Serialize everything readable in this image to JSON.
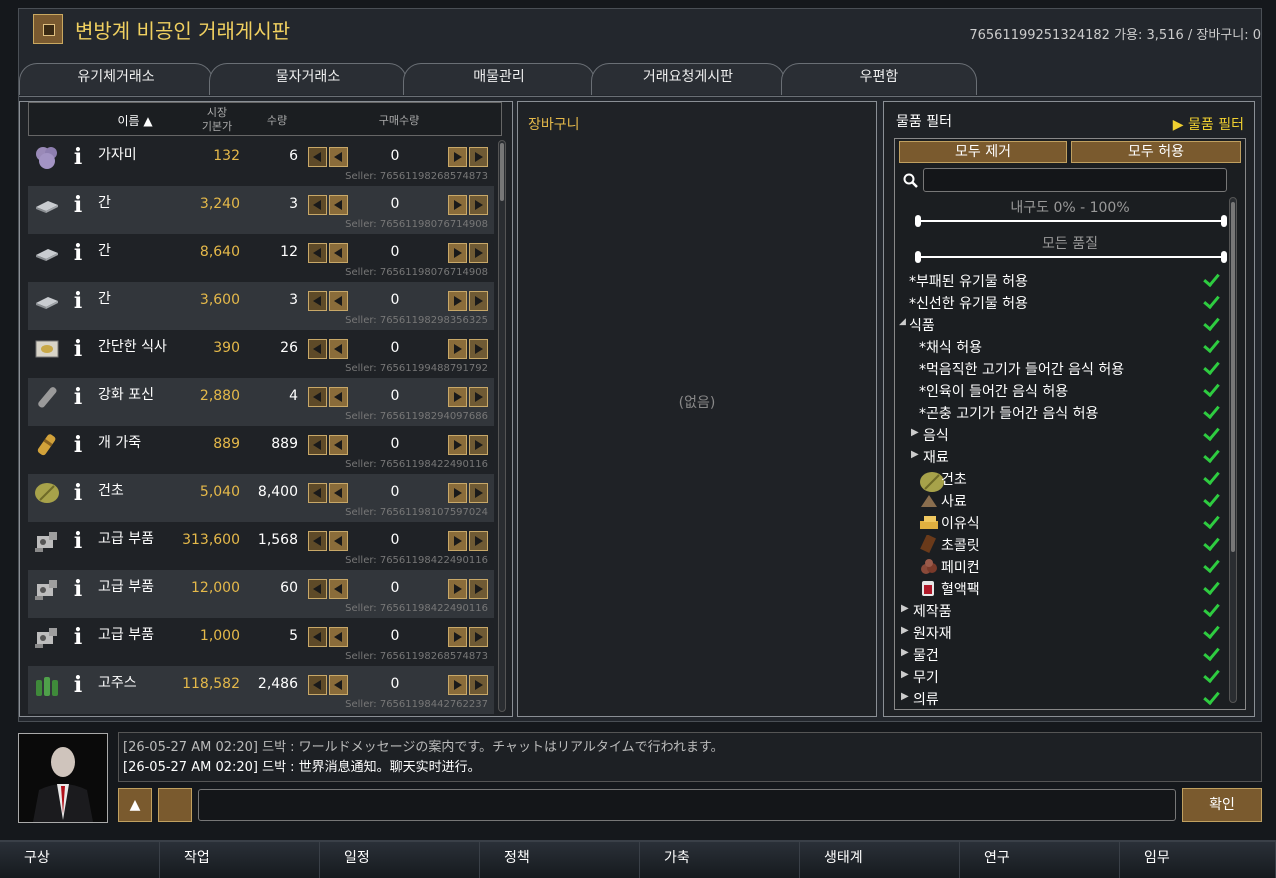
{
  "window": {
    "title": "변방계 비공인 거래게시판",
    "account_info": "76561199251324182   가용: 3,516 / 장바구니: 0"
  },
  "tabs": [
    "유기체거래소",
    "물자거래소",
    "매물관리",
    "거래요청게시판",
    "우편함"
  ],
  "list": {
    "headers": {
      "name": "이름 ▲",
      "base_price_1": "시장",
      "base_price_2": "기본가",
      "qty": "수량",
      "buy_qty": "구매수량"
    },
    "rows": [
      {
        "icon": "lump-purple-icon",
        "name": "가자미",
        "price": "132",
        "qty": "6",
        "buy": "0",
        "seller": "Seller: 76561198268574873"
      },
      {
        "icon": "stone-slab-icon",
        "name": "간",
        "price": "3,240",
        "qty": "3",
        "buy": "0",
        "seller": "Seller: 76561198076714908"
      },
      {
        "icon": "stone-slab-icon",
        "name": "간",
        "price": "8,640",
        "qty": "12",
        "buy": "0",
        "seller": "Seller: 76561198076714908"
      },
      {
        "icon": "stone-slab-icon",
        "name": "간",
        "price": "3,600",
        "qty": "3",
        "buy": "0",
        "seller": "Seller: 76561198298356325"
      },
      {
        "icon": "simple-meal-icon",
        "name": "간단한 식사",
        "price": "390",
        "qty": "26",
        "buy": "0",
        "seller": "Seller: 76561199488791792"
      },
      {
        "icon": "reinforced-barrel-icon",
        "name": "강화 포신",
        "price": "2,880",
        "qty": "4",
        "buy": "0",
        "seller": "Seller: 76561198294097686"
      },
      {
        "icon": "leather-icon",
        "name": "개 가죽",
        "price": "889",
        "qty": "889",
        "buy": "0",
        "seller": "Seller: 76561198422490116"
      },
      {
        "icon": "hay-icon",
        "name": "건초",
        "price": "5,040",
        "qty": "8,400",
        "buy": "0",
        "seller": "Seller: 76561198107597024"
      },
      {
        "icon": "component-icon",
        "name": "고급 부품",
        "price": "313,600",
        "qty": "1,568",
        "buy": "0",
        "seller": "Seller: 76561198422490116"
      },
      {
        "icon": "component-icon",
        "name": "고급 부품",
        "price": "12,000",
        "qty": "60",
        "buy": "0",
        "seller": "Seller: 76561198422490116"
      },
      {
        "icon": "component-icon",
        "name": "고급 부품",
        "price": "1,000",
        "qty": "5",
        "buy": "0",
        "seller": "Seller: 76561198268574873"
      },
      {
        "icon": "beer-bottles-icon",
        "name": "고주스",
        "price": "118,582",
        "qty": "2,486",
        "buy": "0",
        "seller": "Seller: 76561198442762237"
      }
    ]
  },
  "cart": {
    "title": "장바구니",
    "empty": "(없음)"
  },
  "filter": {
    "title": "물품 필터",
    "link": "물품 필터",
    "clear_all": "모두 제거",
    "allow_all": "모두 허용",
    "search_placeholder": "",
    "durability": "내구도 0% - 100%",
    "quality": "모든 품질",
    "tree": [
      {
        "label": "*부패된 유기물 허용",
        "indent": 0,
        "arrow": "",
        "icon": ""
      },
      {
        "label": "*신선한 유기물 허용",
        "indent": 0,
        "arrow": "",
        "icon": ""
      },
      {
        "label": "식품",
        "indent": 0,
        "arrow": "down",
        "icon": ""
      },
      {
        "label": "*채식 허용",
        "indent": 1,
        "arrow": "",
        "icon": ""
      },
      {
        "label": "*먹음직한 고기가 들어간 음식 허용",
        "indent": 1,
        "arrow": "",
        "icon": ""
      },
      {
        "label": "*인육이 들어간 음식 허용",
        "indent": 1,
        "arrow": "",
        "icon": ""
      },
      {
        "label": "*곤충 고기가 들어간 음식 허용",
        "indent": 1,
        "arrow": "",
        "icon": ""
      },
      {
        "label": "음식",
        "indent": 1,
        "arrow": "right",
        "icon": ""
      },
      {
        "label": "재료",
        "indent": 1,
        "arrow": "right",
        "icon": ""
      },
      {
        "label": "건초",
        "indent": 1,
        "arrow": "",
        "icon": "hay-icon"
      },
      {
        "label": "사료",
        "indent": 1,
        "arrow": "",
        "icon": "kibble-icon"
      },
      {
        "label": "이유식",
        "indent": 1,
        "arrow": "",
        "icon": "baby-food-icon"
      },
      {
        "label": "초콜릿",
        "indent": 1,
        "arrow": "",
        "icon": "chocolate-icon"
      },
      {
        "label": "페미컨",
        "indent": 1,
        "arrow": "",
        "icon": "pemmican-icon"
      },
      {
        "label": "혈액팩",
        "indent": 1,
        "arrow": "",
        "icon": "blood-pack-icon"
      },
      {
        "label": "제작품",
        "indent": 0,
        "arrow": "right",
        "icon": ""
      },
      {
        "label": "원자재",
        "indent": 0,
        "arrow": "right",
        "icon": ""
      },
      {
        "label": "물건",
        "indent": 0,
        "arrow": "right",
        "icon": ""
      },
      {
        "label": "무기",
        "indent": 0,
        "arrow": "right",
        "icon": ""
      },
      {
        "label": "의류",
        "indent": 0,
        "arrow": "right",
        "icon": ""
      }
    ]
  },
  "chat": {
    "lines": [
      "[26-05-27 AM 02:20] 드박 : ワールドメッセージの案内です。チャットはリアルタイムで行われます。",
      "[26-05-27 AM 02:20] 드박 : 世界消息通知。聊天实时进行。"
    ],
    "confirm": "확인",
    "input_value": ""
  },
  "bottombar": [
    "구상",
    "작업",
    "일정",
    "정책",
    "가축",
    "생태계",
    "연구",
    "임무"
  ],
  "colors": {
    "accent_gold": "#e5b94a",
    "title_yellow": "#f0d060",
    "check_green": "#2ecc40"
  }
}
